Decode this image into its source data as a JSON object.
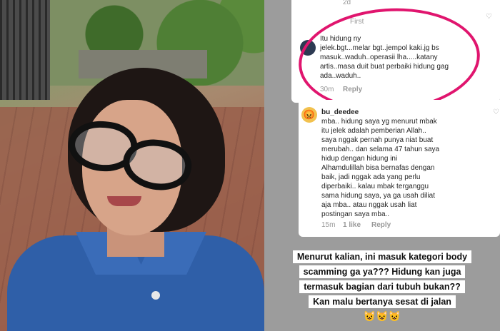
{
  "top_comment_meta": {
    "age": "2d",
    "view_label": "First"
  },
  "main_comment": {
    "text": "Itu hidung ny\njelek.bgt...melar bgt..jempol kaki.jg bs\nmasuk..waduh..operasii lha.....katany\nartis..masa duit buat perbaiki hidung gag\nada..waduh..",
    "time": "30m",
    "reply_label": "Reply"
  },
  "reply_comment": {
    "username": "bu_deedee",
    "text": "mba.. hidung saya yg menurut mbak\nitu jelek adalah pemberian Allah..\nsaya nggak pernah punya niat buat\nmerubah.. dan selama 47 tahun saya\nhidup dengan hidung ini\nAlhamdulillah bisa bernafas dengan\nbaik, jadi nggak ada yang perlu\ndiperbaiki.. kalau mbak terganggu\nsama hidung saya, ya ga usah diliat\naja mba.. atau nggak usah liat\npostingan saya mba..",
    "time": "15m",
    "likes": "1 like",
    "reply_label": "Reply"
  },
  "caption": {
    "lines": [
      "Menurut kalian, ini masuk kategori body",
      "scamming ga ya??? Hidung kan juga",
      "termasuk bagian dari tubuh bukan??",
      "Kan malu bertanya sesat di jalan"
    ],
    "emojis": "😺😺😺"
  },
  "colors": {
    "highlight_circle": "#e0156e",
    "screenshot_bg": "#9c9c9c"
  }
}
